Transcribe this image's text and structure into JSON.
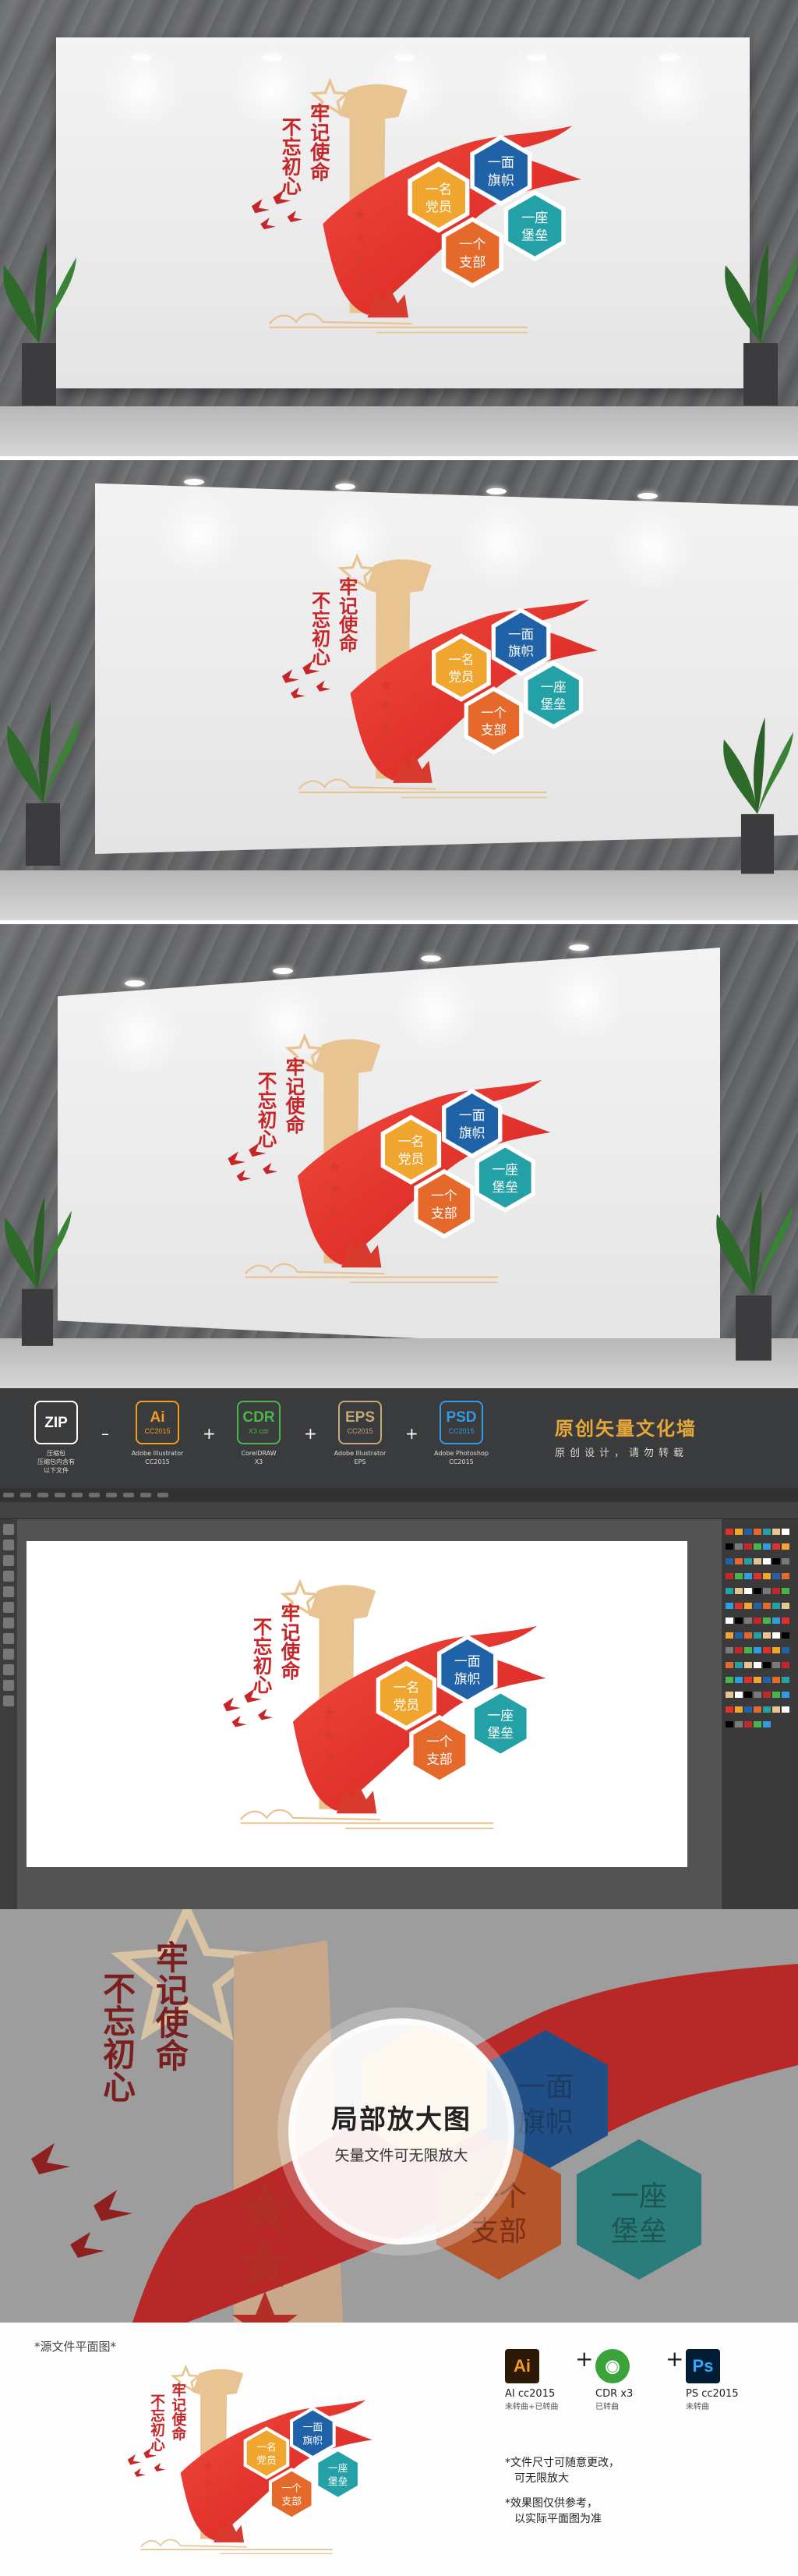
{
  "design": {
    "slogan_left": "不忘初心",
    "slogan_right": "牢记使命",
    "hex_labels": [
      {
        "line1": "一名",
        "line2": "党员",
        "color": "#f0a62e"
      },
      {
        "line1": "一面",
        "line2": "旗帜",
        "color": "#1f62a8"
      },
      {
        "line1": "一个",
        "line2": "支部",
        "color": "#e5692a"
      },
      {
        "line1": "一座",
        "line2": "堡垒",
        "color": "#23a1a6"
      }
    ],
    "colors": {
      "ribbon": "#e0302b",
      "column": "#e8c493",
      "star": "#d93a2e",
      "text_red": "#c4262a"
    }
  },
  "formats": {
    "items": [
      {
        "badge": "ZIP",
        "version": "",
        "caption": "压缩包\n压缩包内含有\n以下文件",
        "color": "#ffffff",
        "sep": ""
      },
      {
        "badge": "Ai",
        "version": "CC2015",
        "caption": "Adobe Illustrator\nCC2015",
        "color": "#f39b22",
        "sep": "–"
      },
      {
        "badge": "CDR",
        "version": "X3 cdr",
        "caption": "CorelDRAW\nX3",
        "color": "#4ab54a",
        "sep": "+"
      },
      {
        "badge": "EPS",
        "version": "CC2015",
        "caption": "Adobe Illustrator\nEPS",
        "color": "#c6a979",
        "sep": "+"
      },
      {
        "badge": "PSD",
        "version": "CC2015",
        "caption": "Adobe Photoshop\nCC2015",
        "color": "#2f9de0",
        "sep": "+"
      }
    ],
    "brand_title": "原创矢量文化墙",
    "brand_sub": "原创设计，请勿转载"
  },
  "zoom": {
    "title": "局部放大图",
    "subtitle": "矢量文件可无限放大"
  },
  "bottom": {
    "source_label": "*源文件平面图*",
    "software": [
      {
        "icon": "Ai",
        "name": "AI cc2015",
        "note": "未转曲+已转曲",
        "color": "#f39b22",
        "bg": "#2b1a07"
      },
      {
        "icon": "◉",
        "name": "CDR x3",
        "note": "已转曲",
        "color": "#ffffff",
        "bg": "#3aa33a"
      },
      {
        "icon": "Ps",
        "name": "PS cc2015",
        "note": "未转曲",
        "color": "#31a8ff",
        "bg": "#001d34"
      }
    ],
    "notes": [
      "*文件尺寸可随意更改，",
      "可无限放大",
      "*效果图仅供参考，",
      "以实际平面图为准"
    ]
  }
}
